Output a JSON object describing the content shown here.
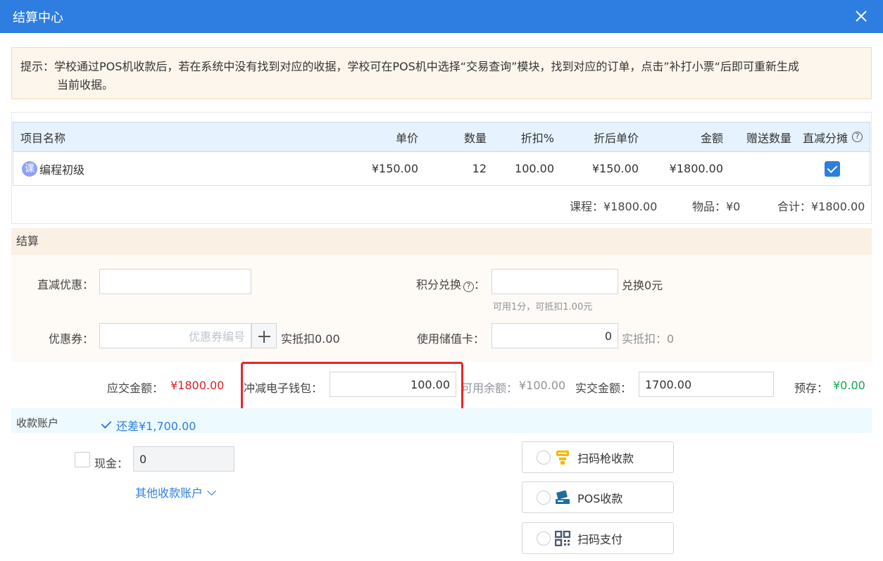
{
  "dialog": {
    "title": "结算中心"
  },
  "tip": {
    "line1": "提示：学校通过POS机收款后，若在系统中没有找到对应的收据，学校可在POS机中选择“交易查询”模块，找到对应的订单，点击”补打小票“后即可重新生成",
    "line2": "当前收据。"
  },
  "table": {
    "headers": {
      "name": "项目名称",
      "unit_price": "单价",
      "quantity": "数量",
      "discount": "折扣%",
      "discounted_price": "折后单价",
      "amount": "金额",
      "gift_qty": "赠送数量",
      "direct_alloc": "直减分摊"
    },
    "rows": [
      {
        "badge": "课",
        "name": "编程初级",
        "unit_price": "¥150.00",
        "quantity": "12",
        "discount": "100.00",
        "discounted_price": "¥150.00",
        "amount": "¥1800.00",
        "gift_qty": "",
        "direct_alloc_checked": true
      }
    ],
    "summary": {
      "course": "课程：¥1800.00",
      "goods": "物品：¥0",
      "total": "合计：¥1800.00"
    }
  },
  "settlement": {
    "title": "结算",
    "direct_discount_label": "直减优惠：",
    "direct_discount_value": "",
    "points_label": "积分兑换",
    "points_colon": "：",
    "points_value": "",
    "points_exchange": "兑换0元",
    "points_hint": "可用1分，可抵扣1.00元",
    "coupon_label": "优惠券：",
    "coupon_placeholder": "优惠券编号",
    "coupon_deduct": "实抵扣0.00",
    "stored_card_label": "使用储值卡：",
    "stored_card_value": "0",
    "stored_card_deduct": "实抵扣：0"
  },
  "payment": {
    "due_label": "应交金额：",
    "due_value": "¥1800.00",
    "ewallet_label": "冲减电子钱包：",
    "ewallet_value": "100.00",
    "available_label": "可用余额：",
    "available_value": "¥100.00",
    "actual_label": "实交金额：",
    "actual_value": "1700.00",
    "prestore_label": "预存：",
    "prestore_value": "¥0.00"
  },
  "account": {
    "title": "收款账户",
    "remaining": "还差¥1,700.00",
    "cash_label": "现金：",
    "cash_value": "0",
    "other_accounts": "其他收款账户",
    "methods": [
      {
        "label": "扫码枪收款",
        "icon": "scanner-icon"
      },
      {
        "label": "POS收款",
        "icon": "pos-card-icon"
      },
      {
        "label": "扫码支付",
        "icon": "qr-code-icon"
      }
    ]
  },
  "colors": {
    "accent": "#2d7ee0",
    "danger": "#e02020",
    "success": "#13a84e",
    "warning": "#f5b800"
  }
}
